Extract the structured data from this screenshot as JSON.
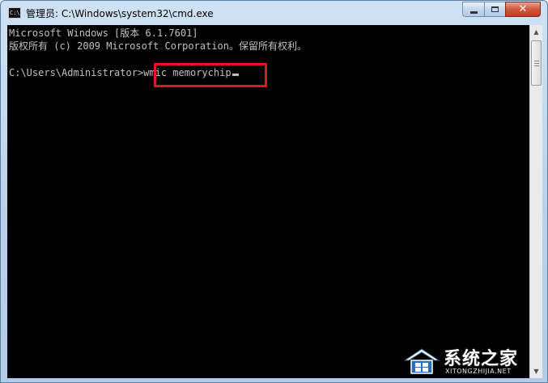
{
  "window": {
    "title": "管理员: C:\\Windows\\system32\\cmd.exe",
    "icon": "cmd-icon"
  },
  "caption_buttons": {
    "minimize": "minimize-icon",
    "maximize": "maximize-icon",
    "close": "close-icon",
    "close_color": "#c73c1f"
  },
  "console": {
    "background": "#000000",
    "foreground": "#c0c0c0",
    "lines": [
      "Microsoft Windows [版本 6.1.7601]",
      "版权所有 (c) 2009 Microsoft Corporation。保留所有权利。",
      "",
      "C:\\Users\\Administrator>wmic memorychip"
    ],
    "prompt": "C:\\Users\\Administrator>",
    "command": "wmic memorychip",
    "highlight_color": "#e0191f"
  },
  "watermark": {
    "text": "系统之家",
    "sub": "XITONGZHIJIA.NET"
  }
}
